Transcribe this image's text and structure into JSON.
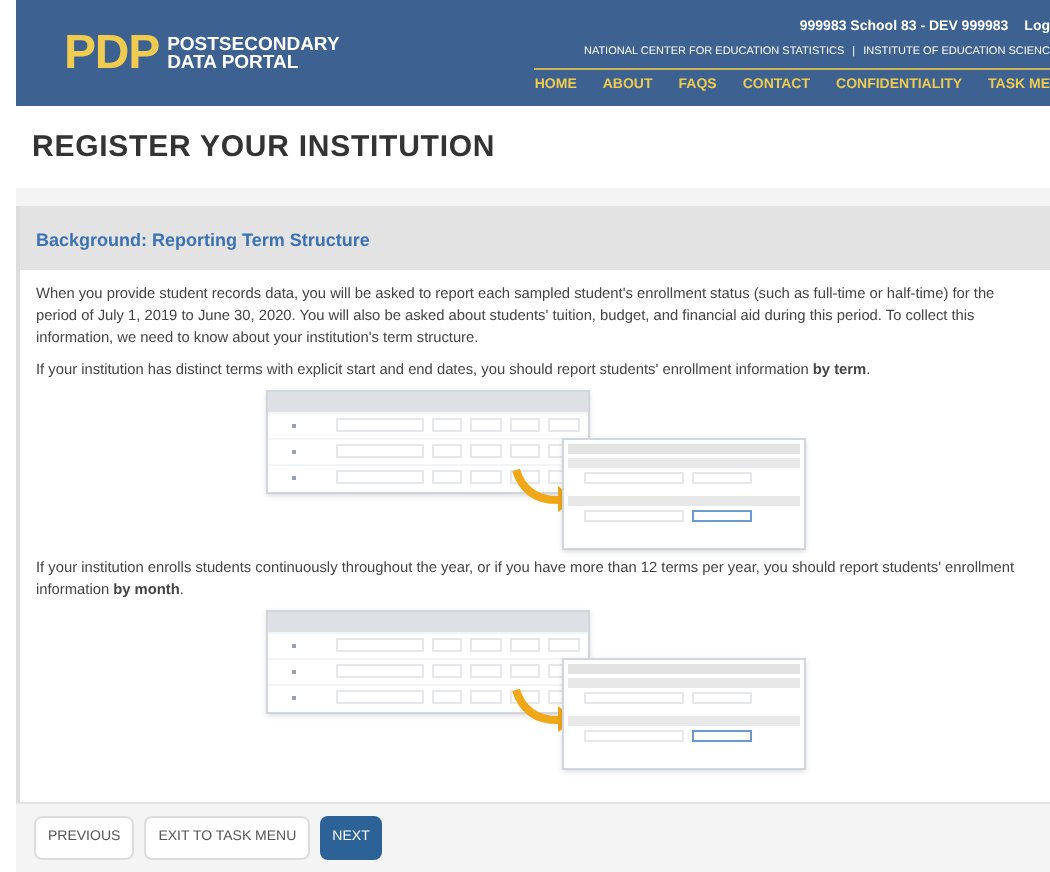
{
  "header": {
    "logo_mark": "PDP",
    "logo_lines": [
      "POSTSECONDARY",
      "DATA PORTAL"
    ],
    "user_info": "999983 School 83 - DEV  999983",
    "login": "Log",
    "agency_links": [
      {
        "label": "NATIONAL CENTER FOR EDUCATION STATISTICS"
      },
      {
        "label": "INSTITUTE OF EDUCATION SCIENC"
      }
    ],
    "separator": "|",
    "nav": [
      {
        "label": "HOME"
      },
      {
        "label": "ABOUT"
      },
      {
        "label": "FAQS"
      },
      {
        "label": "CONTACT"
      },
      {
        "label": "CONFIDENTIALITY"
      },
      {
        "label": "TASK ME"
      }
    ]
  },
  "page_title": "REGISTER YOUR INSTITUTION",
  "panel": {
    "title": "Background: Reporting Term Structure",
    "blocks": [
      {
        "kind": "text",
        "text": "When you provide student records data, you will be asked to report each sampled student's enrollment status (such as full-time or half-time) for the period of July 1, 2019 to June 30, 2020. You will also be asked about students' tuition, budget, and financial aid during this period. To collect this information, we need to know about your institution's term structure."
      },
      {
        "kind": "text",
        "text": "If your institution has distinct terms with explicit start and end dates, you should report students' enrollment information **by term**."
      },
      {
        "kind": "figure"
      },
      {
        "kind": "text",
        "text": "If your institution enrolls students continuously throughout the year, or if you have more than 12 terms per year, you should report students' enrollment information **by month**."
      },
      {
        "kind": "figure"
      }
    ]
  },
  "buttons": [
    {
      "label": "PREVIOUS",
      "kind": "secondary"
    },
    {
      "label": "EXIT TO TASK MENU",
      "kind": "secondary"
    },
    {
      "label": "NEXT",
      "kind": "primary"
    }
  ]
}
